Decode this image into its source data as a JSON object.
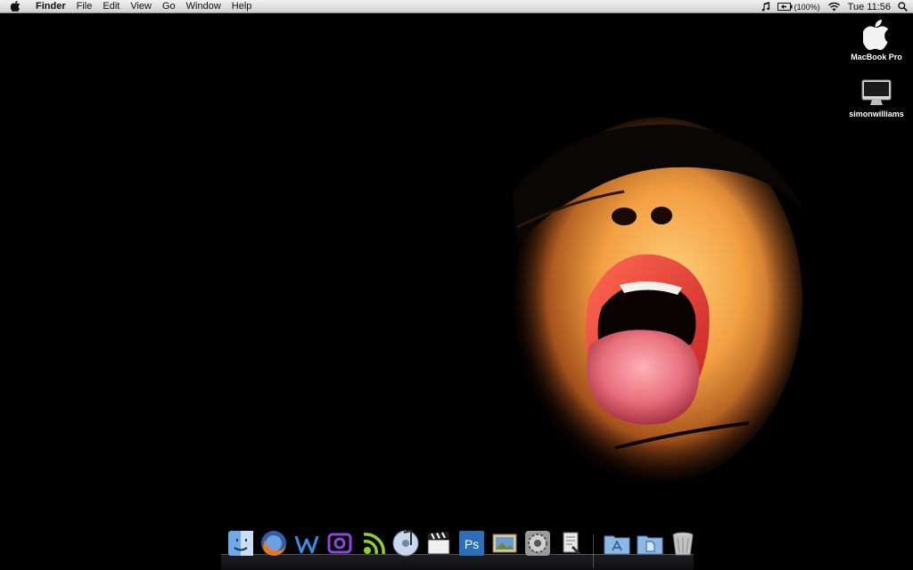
{
  "menubar": {
    "app_name": "Finder",
    "menus": [
      "File",
      "Edit",
      "View",
      "Go",
      "Window",
      "Help"
    ],
    "battery_text": "(100%)",
    "clock": "Tue 11:56"
  },
  "desktop": {
    "icons": [
      {
        "label": "MacBook Pro",
        "icon": "apple-logo-icon"
      },
      {
        "label": "simonwilliams",
        "icon": "imac-icon"
      }
    ]
  },
  "dock": {
    "items": [
      "finder-icon",
      "firefox-icon",
      "text-editor-icon",
      "mail-icon",
      "network-app-icon",
      "itunes-icon",
      "final-cut-icon",
      "photoshop-icon",
      "iphoto-icon",
      "system-preferences-icon",
      "script-editor-icon",
      "applications-folder-icon",
      "documents-folder-icon",
      "trash-icon"
    ],
    "photoshop_label": "Ps"
  },
  "colors": {
    "menubar": "#dcdcdc",
    "desktop_bg": "#000000",
    "lips": "#d8322e",
    "skin": "#f4a24a"
  }
}
